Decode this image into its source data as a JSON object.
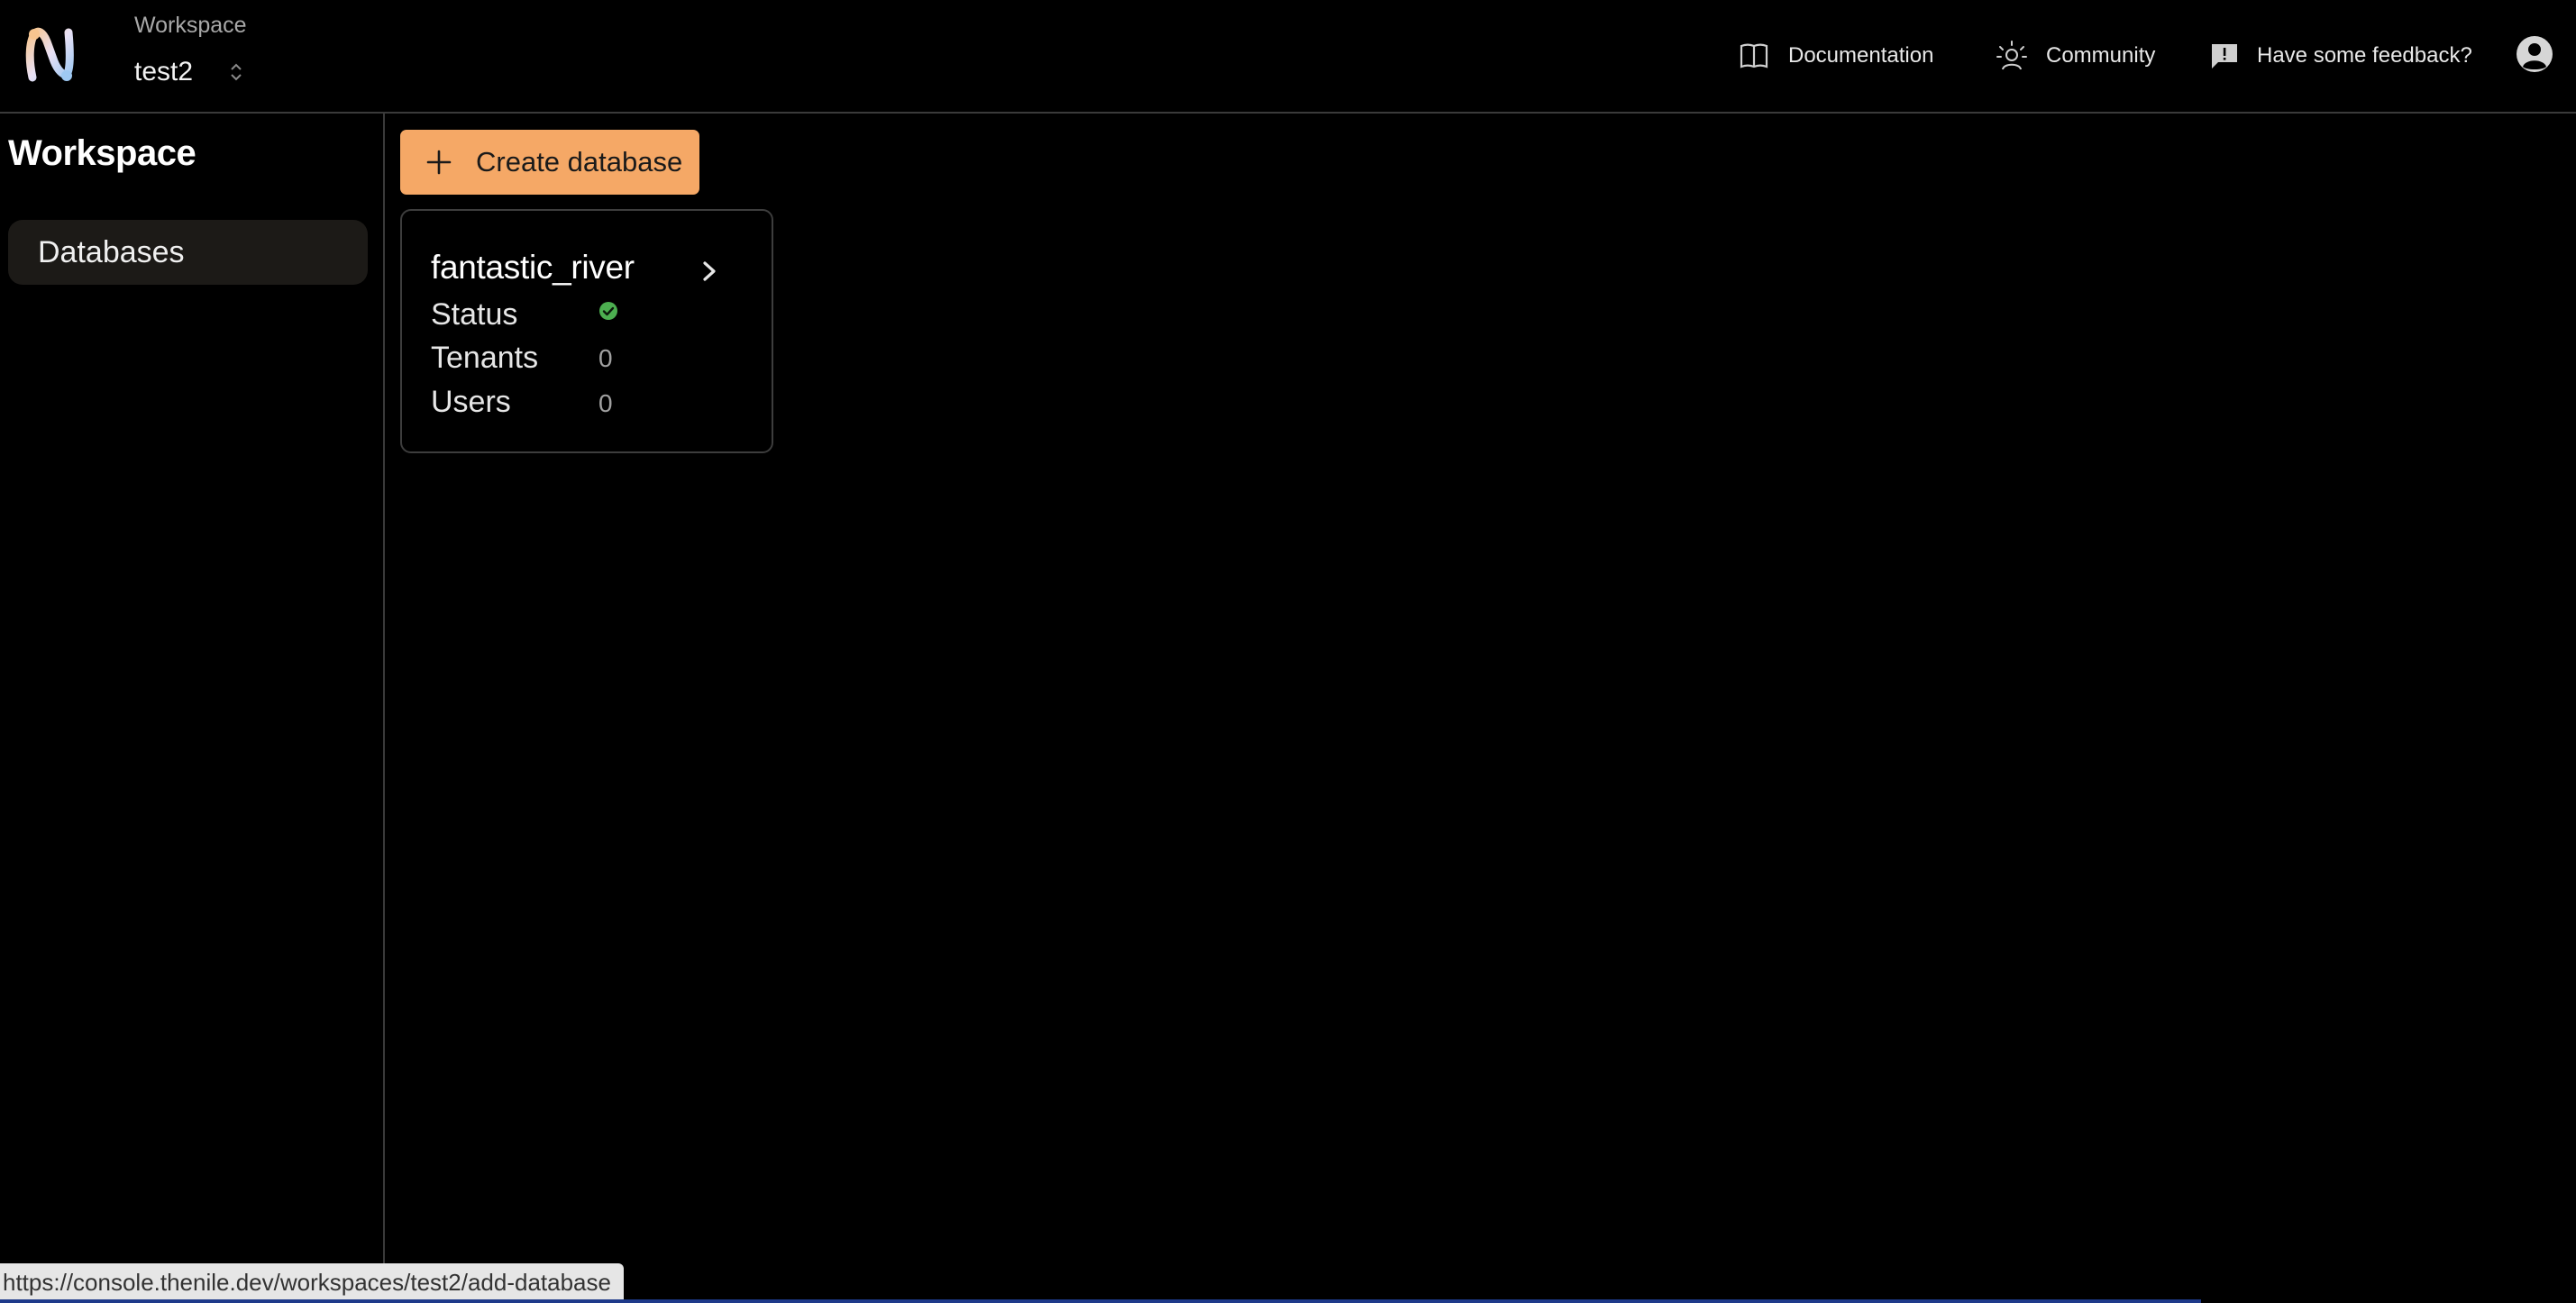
{
  "header": {
    "workspace_label": "Workspace",
    "workspace_name": "test2",
    "links": {
      "documentation": "Documentation",
      "community": "Community",
      "feedback": "Have some feedback?"
    }
  },
  "sidebar": {
    "title": "Workspace",
    "items": [
      {
        "label": "Databases",
        "icon": "none"
      }
    ]
  },
  "main": {
    "create_button_label": "Create database",
    "databases": [
      {
        "name": "fantastic_river",
        "status_label": "Status",
        "status_icon": "check-circle-icon",
        "tenants_label": "Tenants",
        "tenants_value": "0",
        "users_label": "Users",
        "users_value": "0"
      }
    ]
  },
  "status_bar": {
    "url": "https://console.thenile.dev/workspaces/test2/add-database"
  },
  "colors": {
    "background": "#000000",
    "accent": "#f5a866",
    "status_ok": "#4caf50",
    "sidebar_active": "#1c1a17"
  }
}
